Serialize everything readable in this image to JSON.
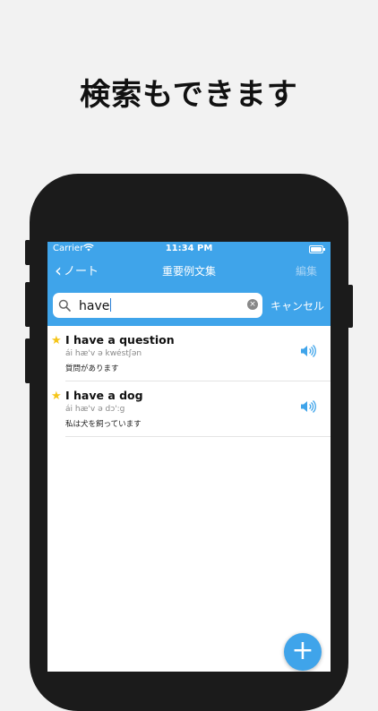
{
  "headline": "検索もできます",
  "status_bar": {
    "carrier": "Carrier",
    "time": "11:34 PM"
  },
  "nav": {
    "back_label": "ノート",
    "title": "重要例文集",
    "edit_label": "編集"
  },
  "search": {
    "query": "have",
    "cancel_label": "キャンセル"
  },
  "results": [
    {
      "sentence": "I have a question",
      "pronunciation": "ái hæ'v ə kwéstʃən",
      "translation": "質問があります",
      "starred": true
    },
    {
      "sentence": "I have a dog",
      "pronunciation": "ái hæ'v ə dɔ':g",
      "translation": "私は犬を飼っています",
      "starred": true
    }
  ],
  "icons": {
    "star": "★",
    "fab": "+"
  },
  "colors": {
    "accent": "#3fa4ea",
    "star": "#f5c518",
    "background": "#f2f2f2",
    "phone": "#1b1b1b"
  }
}
